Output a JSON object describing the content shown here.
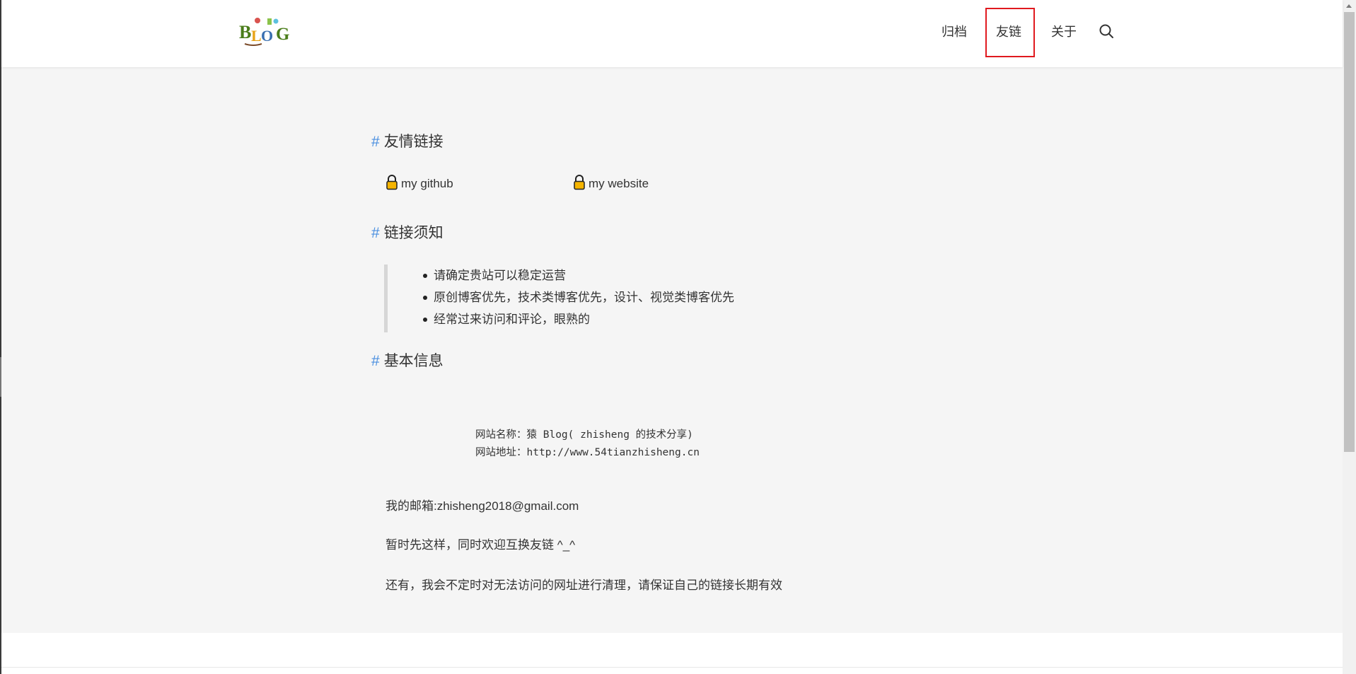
{
  "header": {
    "logo_alt": "BLOG",
    "nav": {
      "archive": "归档",
      "friends": "友链",
      "about": "关于"
    }
  },
  "sections": {
    "links_title": "友情链接",
    "notes_title": "链接须知",
    "info_title": "基本信息",
    "hash": "#"
  },
  "links": {
    "github": "my github",
    "website": "my website"
  },
  "notes": [
    "请确定贵站可以稳定运营",
    "原创博客优先，技术类博客优先，设计、视觉类博客优先",
    "经常过来访问和评论，眼熟的"
  ],
  "info": {
    "site_name": "网站名称：猿 Blog( zhisheng 的技术分享)",
    "site_url": "网站地址：http://www.54tianzhisheng.cn",
    "email": "我的邮箱:zhisheng2018@gmail.com",
    "welcome": "暂时先这样，同时欢迎互换友链 ^_^",
    "notice": "还有，我会不定时对无法访问的网址进行清理，请保证自己的链接长期有效"
  },
  "colors": {
    "accent_hash": "#4a8fe0",
    "highlight_box": "#e0191f",
    "background": "#f5f5f5"
  },
  "icons": [
    "lock-icon",
    "search-icon",
    "scroll-up-arrow-icon"
  ]
}
